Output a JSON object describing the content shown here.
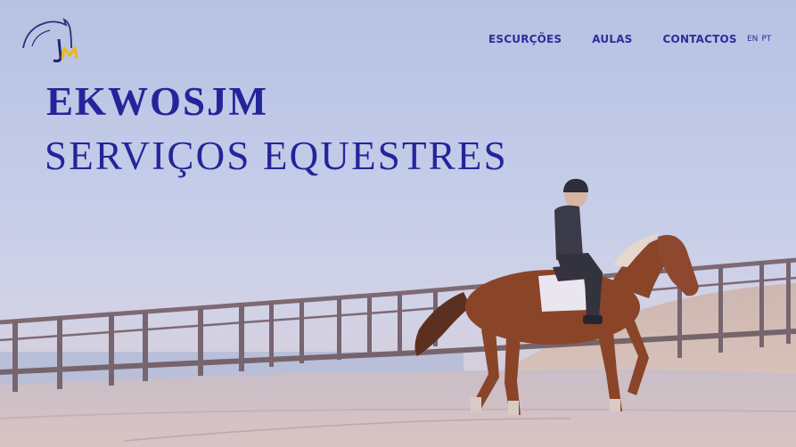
{
  "header": {
    "nav": [
      "ESCURÇÕES",
      "AULAS",
      "CONTACTOS"
    ],
    "languages": [
      "EN",
      "PT"
    ]
  },
  "hero": {
    "title": "EKWOSJM",
    "subtitle": "SERVIÇOS EQUESTRES"
  },
  "colors": {
    "brand_blue": "#24249a",
    "logo_yellow": "#e8b820"
  },
  "icons": {
    "logo": "horse-head-jm-logo"
  }
}
